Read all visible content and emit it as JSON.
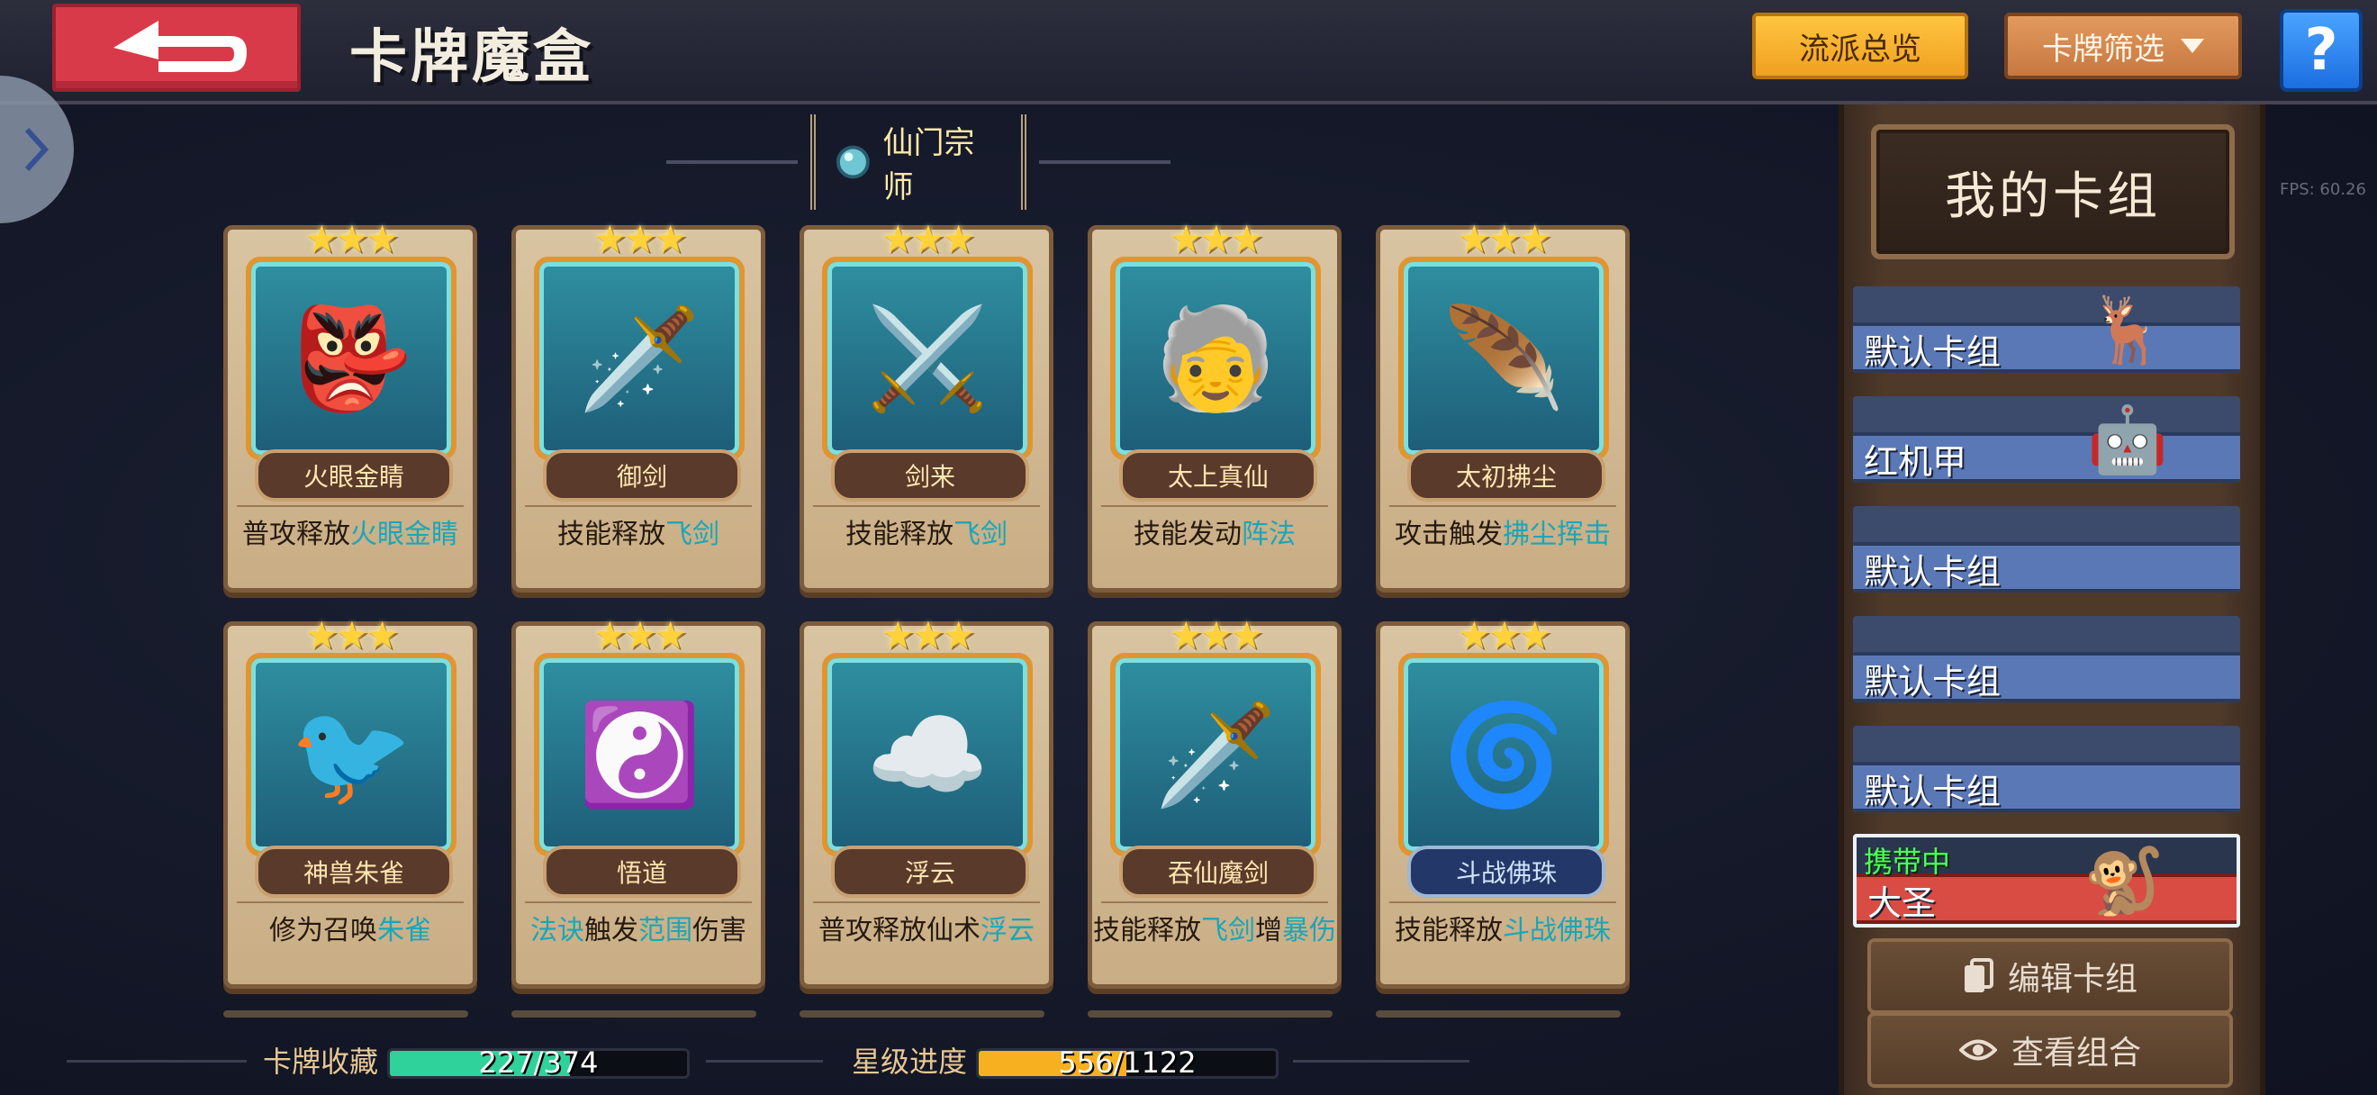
{
  "header": {
    "title": "卡牌魔盒",
    "overview_button": "流派总览",
    "filter_button": "卡牌筛选",
    "help_label": "?"
  },
  "section": {
    "label": "仙门宗师"
  },
  "cards": [
    {
      "name": "火眼金睛",
      "desc_plain": "普攻释放",
      "desc_hl": "火眼金睛",
      "desc_tail": "",
      "emblem": "👺"
    },
    {
      "name": "御剑",
      "desc_plain": "技能释放",
      "desc_hl": "飞剑",
      "desc_tail": "",
      "emblem": "🗡️"
    },
    {
      "name": "剑来",
      "desc_plain": "技能释放",
      "desc_hl": "飞剑",
      "desc_tail": "",
      "emblem": "⚔️"
    },
    {
      "name": "太上真仙",
      "desc_plain": "技能发动",
      "desc_hl": "阵法",
      "desc_tail": "",
      "emblem": "🧓"
    },
    {
      "name": "太初拂尘",
      "desc_plain": "攻击触发",
      "desc_hl": "拂尘挥击",
      "desc_tail": "",
      "emblem": "🪶"
    },
    {
      "name": "神兽朱雀",
      "desc_plain": "修为召唤",
      "desc_hl": "朱雀",
      "desc_tail": "",
      "emblem": "🐦"
    },
    {
      "name": "悟道",
      "desc_plain": "",
      "desc_hl": "法诀",
      "desc_mid": "触发",
      "desc_hl2": "范围",
      "desc_tail": "伤害",
      "emblem": "☯️"
    },
    {
      "name": "浮云",
      "desc_plain": "普攻释放仙术",
      "desc_hl": "浮云",
      "desc_tail": "",
      "emblem": "☁️"
    },
    {
      "name": "吞仙魔剑",
      "desc_plain": "技能释放",
      "desc_hl": "飞剑",
      "desc_mid": "增",
      "desc_hl2": "暴伤",
      "desc_tail": "",
      "emblem": "🗡️"
    },
    {
      "name": "斗战佛珠",
      "desc_plain": "技能释放",
      "desc_hl": "斗战佛珠",
      "desc_tail": "",
      "emblem": "🌀"
    }
  ],
  "progress": {
    "collection_label": "卡牌收藏",
    "collection_text": "227/374",
    "collection_fraction": 0.607,
    "star_label": "星级进度",
    "star_text": "556/1122",
    "star_fraction": 0.496
  },
  "panel": {
    "title": "我的卡组",
    "decks": [
      {
        "name": "默认卡组",
        "portrait": "🦌",
        "active": false
      },
      {
        "name": "红机甲",
        "portrait": "🤖",
        "active": false
      },
      {
        "name": "默认卡组",
        "portrait": "",
        "active": false
      },
      {
        "name": "默认卡组",
        "portrait": "",
        "active": false
      },
      {
        "name": "默认卡组",
        "portrait": "",
        "active": false
      },
      {
        "name": "大圣",
        "portrait": "🐒",
        "active": true,
        "status": "携带中"
      }
    ],
    "edit_button": "编辑卡组",
    "view_button": "查看组合"
  },
  "fps_text": "FPS: 60.26",
  "colors": {
    "accent_orange": "#f0a020",
    "highlight_text": "#1aa6b8",
    "collection_bar": "#2ed29a",
    "star_bar": "#f6b020"
  }
}
